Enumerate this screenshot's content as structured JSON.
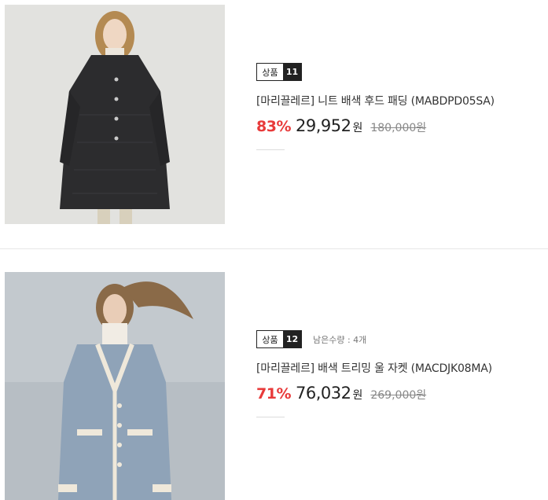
{
  "products": [
    {
      "badge_label": "상품",
      "badge_number": "11",
      "stock": "",
      "title": "[마리끌레르] 니트 배색 후드 패딩 (MABDPD05SA)",
      "discount": "83%",
      "price": "29,952",
      "currency": "원",
      "original_price": "180,000원",
      "image": "model-black-long-padded-coat"
    },
    {
      "badge_label": "상품",
      "badge_number": "12",
      "stock": "남은수량 : 4개",
      "title": "[마리끌레르] 배색 트리밍 울 자켓 (MACDJK08MA)",
      "discount": "71%",
      "price": "76,032",
      "currency": "원",
      "original_price": "269,000원",
      "image": "model-blue-wool-jacket"
    }
  ],
  "colors": {
    "discount": "#e83a3a",
    "badge_dark": "#222222",
    "strike": "#888888"
  }
}
